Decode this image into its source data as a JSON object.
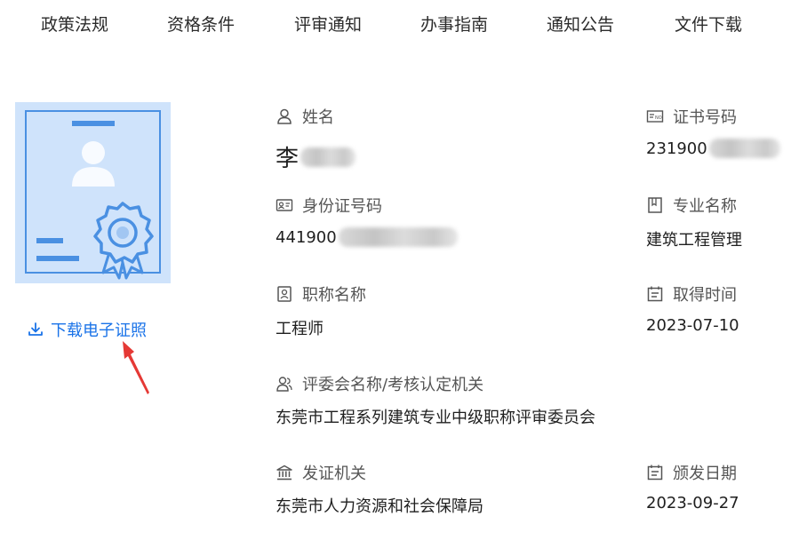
{
  "nav": {
    "items": [
      "政策法规",
      "资格条件",
      "评审通知",
      "办事指南",
      "通知公告",
      "文件下载"
    ]
  },
  "download": {
    "label": "下载电子证照"
  },
  "fields": {
    "name": {
      "label": "姓名",
      "value": "李"
    },
    "cert_no": {
      "label": "证书号码",
      "value": "231900"
    },
    "id_no": {
      "label": "身份证号码",
      "value": "441900"
    },
    "major": {
      "label": "专业名称",
      "value": "建筑工程管理"
    },
    "title": {
      "label": "职称名称",
      "value": "工程师"
    },
    "obtain_date": {
      "label": "取得时间",
      "value": "2023-07-10"
    },
    "committee": {
      "label": "评委会名称/考核认定机关",
      "value": "东莞市工程系列建筑专业中级职称评审委员会"
    },
    "issuer": {
      "label": "发证机关",
      "value": "东莞市人力资源和社会保障局"
    },
    "issue_date": {
      "label": "颁发日期",
      "value": "2023-09-27"
    }
  },
  "colors": {
    "accent": "#1a73e8",
    "cert_bg": "#cfe3fb",
    "cert_line": "#4a90e2",
    "arrow": "#e53935"
  }
}
